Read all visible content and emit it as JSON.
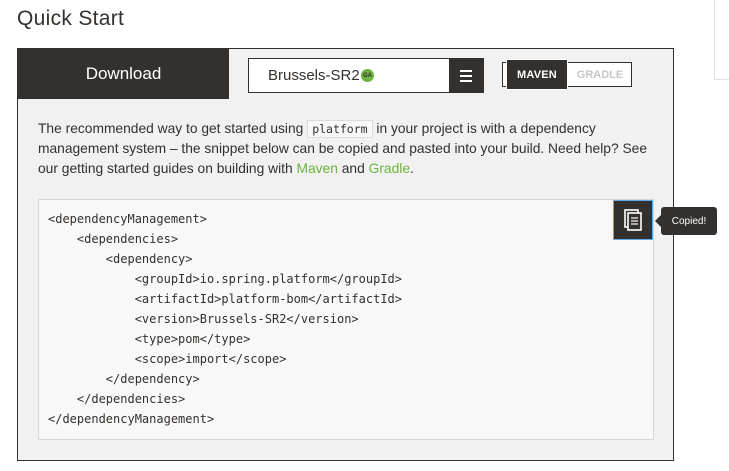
{
  "page": {
    "title": "Quick Start"
  },
  "tabs": {
    "download": "Download"
  },
  "version_select": {
    "value": "Brussels-SR2",
    "badge": "GA"
  },
  "build_tool": {
    "options": [
      "MAVEN",
      "GRADLE"
    ],
    "selected": "MAVEN"
  },
  "description": {
    "part1": "The recommended way to get started using ",
    "code": "platform",
    "part2": " in your project is with a dependency management system – the snippet below can be copied and pasted into your build. Need help? See our getting started guides on building with ",
    "maven_link": "Maven",
    "part3": " and ",
    "gradle_link": "Gradle",
    "part4": "."
  },
  "code": {
    "lines": [
      "<dependencyManagement>",
      "    <dependencies>",
      "        <dependency>",
      "            <groupId>io.spring.platform</groupId>",
      "            <artifactId>platform-bom</artifactId>",
      "            <version>Brussels-SR2</version>",
      "            <type>pom</type>",
      "            <scope>import</scope>",
      "        </dependency>",
      "    </dependencies>",
      "</dependencyManagement>"
    ]
  },
  "copy": {
    "tooltip": "Copied!"
  },
  "colors": {
    "dark": "#34302d",
    "green": "#6db33f",
    "copy_border": "#5da9e9"
  }
}
